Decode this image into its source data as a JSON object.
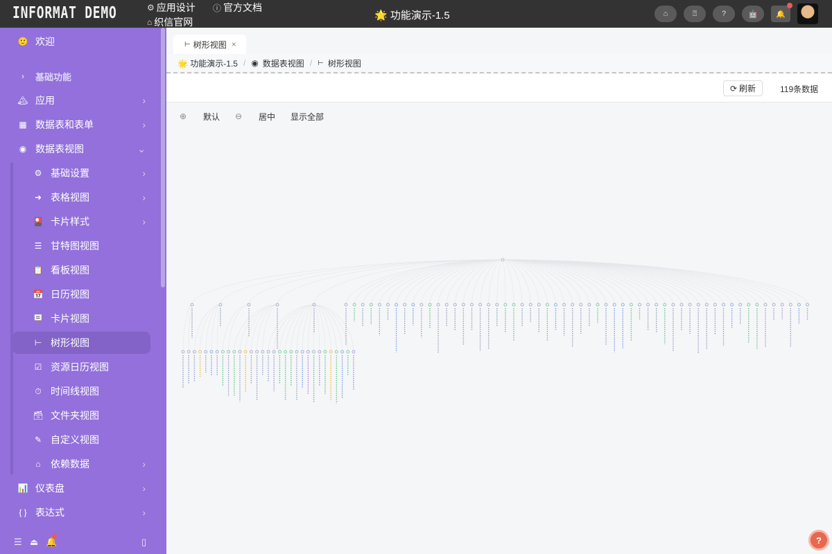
{
  "header": {
    "logo": "INFORMAT DEMO",
    "links": [
      {
        "label": "应用设计",
        "icon": "gear-icon"
      },
      {
        "label": "官方文档",
        "icon": "info-icon"
      },
      {
        "label": "织信官网",
        "icon": "home-icon"
      }
    ],
    "app_title": "🌟 功能演示-1.5",
    "buttons": [
      "home-icon",
      "help-doc-icon",
      "question-icon",
      "robot-icon",
      "bell-icon"
    ]
  },
  "sidebar": {
    "welcome": "欢迎",
    "section": "基础功能",
    "items": [
      {
        "label": "应用",
        "icon": "🏔"
      },
      {
        "label": "数据表和表单",
        "icon": "▦"
      },
      {
        "label": "数据表视图",
        "icon": "◉"
      }
    ],
    "sub_items": [
      {
        "label": "基础设置",
        "icon": "⚙"
      },
      {
        "label": "表格视图",
        "icon": "➜"
      },
      {
        "label": "卡片样式",
        "icon": "🎴"
      },
      {
        "label": "甘特图视图",
        "icon": "☰"
      },
      {
        "label": "看板视图",
        "icon": "📋"
      },
      {
        "label": "日历视图",
        "icon": "📅"
      },
      {
        "label": "卡片视图",
        "icon": "🪧"
      },
      {
        "label": "树形视图",
        "icon": "⊢"
      },
      {
        "label": "资源日历视图",
        "icon": "☑"
      },
      {
        "label": "时间线视图",
        "icon": "⏱"
      },
      {
        "label": "文件夹视图",
        "icon": "🗃"
      },
      {
        "label": "自定义视图",
        "icon": "✎"
      },
      {
        "label": "依赖数据",
        "icon": "⌂"
      }
    ],
    "bottom_items": [
      {
        "label": "仪表盘",
        "icon": "📊"
      },
      {
        "label": "表达式",
        "icon": "{ }"
      }
    ]
  },
  "tab": {
    "label": "树形视图",
    "close": "×"
  },
  "breadcrumb": [
    "🌟 功能演示-1.5",
    "数据表视图",
    "树形视图"
  ],
  "toolbar": {
    "refresh": "刷新",
    "count": "119条数据"
  },
  "zoom": {
    "default": "默认",
    "center": "居中",
    "show_all": "显示全部"
  },
  "colors": {
    "accent": "#9370db",
    "topbar": "#333333"
  }
}
